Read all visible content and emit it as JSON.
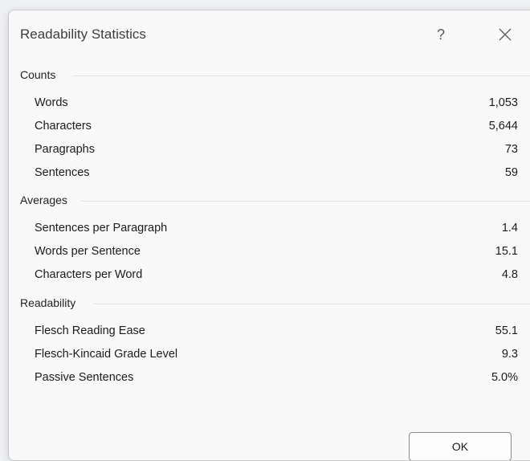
{
  "dialog": {
    "title": "Readability Statistics",
    "help_label": "?",
    "ok_label": "OK"
  },
  "counts": {
    "heading": "Counts",
    "rows": [
      {
        "label": "Words",
        "value": "1,053"
      },
      {
        "label": "Characters",
        "value": "5,644"
      },
      {
        "label": "Paragraphs",
        "value": "73"
      },
      {
        "label": "Sentences",
        "value": "59"
      }
    ]
  },
  "averages": {
    "heading": "Averages",
    "rows": [
      {
        "label": "Sentences per Paragraph",
        "value": "1.4"
      },
      {
        "label": "Words per Sentence",
        "value": "15.1"
      },
      {
        "label": "Characters per Word",
        "value": "4.8"
      }
    ]
  },
  "readability": {
    "heading": "Readability",
    "rows": [
      {
        "label": "Flesch Reading Ease",
        "value": "55.1"
      },
      {
        "label": "Flesch-Kincaid Grade Level",
        "value": "9.3"
      },
      {
        "label": "Passive Sentences",
        "value": "5.0%"
      }
    ]
  },
  "icons": {
    "help": "question-mark-icon",
    "close": "close-icon"
  }
}
